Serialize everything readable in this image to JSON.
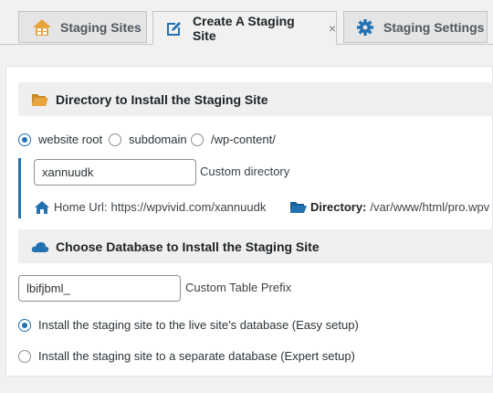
{
  "tabs": [
    {
      "label": "Staging Sites",
      "icon": "house-icon"
    },
    {
      "label": "Create A Staging Site",
      "icon": "edit-icon",
      "close": "×"
    },
    {
      "label": "Staging Settings",
      "icon": "gear-icon"
    }
  ],
  "directory_section": {
    "title": "Directory to Install the Staging Site",
    "icon": "folder-open-icon",
    "options": [
      "website root",
      "subdomain",
      "/wp-content/"
    ],
    "selected": "website root",
    "custom_dir_value": "xannuudk",
    "custom_dir_label": "Custom directory",
    "home_url_label": "Home Url:",
    "home_url_value": "https://wpvivid.com/xannuudk",
    "directory_label": "Directory:",
    "directory_value": "/var/www/html/pro.wpv"
  },
  "database_section": {
    "title": "Choose Database to Install the Staging Site",
    "icon": "cloud-icon",
    "prefix_value": "lbifjbml_",
    "prefix_label": "Custom Table Prefix",
    "options": [
      "Install the staging site to the live site's database (Easy setup)",
      "Install the staging site to a separate database (Expert setup)"
    ],
    "selected": "Install the staging site to the live site's database (Easy setup)"
  },
  "colors": {
    "accent": "#2271b1",
    "folder": "#e8a33d",
    "house": "#e8a33d"
  }
}
